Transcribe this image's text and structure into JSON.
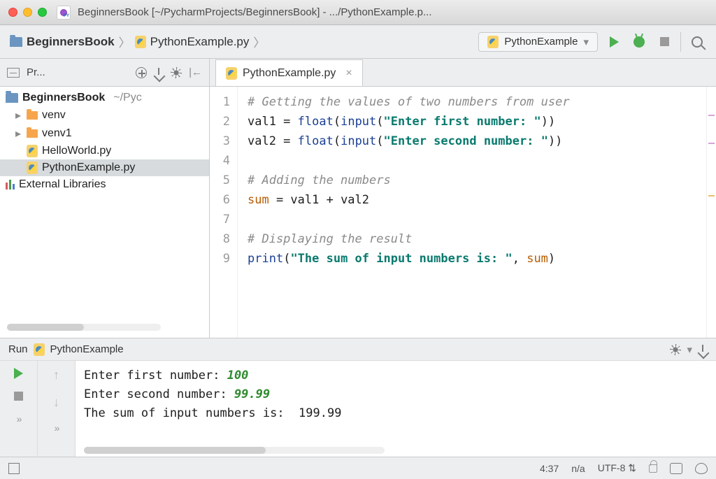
{
  "title": "BeginnersBook [~/PycharmProjects/BeginnersBook] - .../PythonExample.p...",
  "breadcrumbs": {
    "root": "BeginnersBook",
    "file": "PythonExample.py"
  },
  "run_config": {
    "name": "PythonExample"
  },
  "project": {
    "pane_label": "Pr...",
    "root_name": "BeginnersBook",
    "root_path": "~/Pyc",
    "items": [
      {
        "name": "venv",
        "type": "folder"
      },
      {
        "name": "venv1",
        "type": "folder"
      },
      {
        "name": "HelloWorld.py",
        "type": "py"
      },
      {
        "name": "PythonExample.py",
        "type": "py",
        "selected": true
      }
    ],
    "external": "External Libraries"
  },
  "editor": {
    "tab_name": "PythonExample.py",
    "highlight_line": 6,
    "lines": [
      [
        {
          "t": "# Getting the values of two numbers from user",
          "c": "cm"
        }
      ],
      [
        {
          "t": "val1 = ",
          "c": "var"
        },
        {
          "t": "float",
          "c": "fn"
        },
        {
          "t": "(",
          "c": ""
        },
        {
          "t": "input",
          "c": "fn"
        },
        {
          "t": "(",
          "c": ""
        },
        {
          "t": "\"Enter first number: \"",
          "c": "str"
        },
        {
          "t": "))",
          "c": ""
        }
      ],
      [
        {
          "t": "val2 = ",
          "c": "var"
        },
        {
          "t": "float",
          "c": "fn"
        },
        {
          "t": "(",
          "c": ""
        },
        {
          "t": "input",
          "c": "fn"
        },
        {
          "t": "(",
          "c": ""
        },
        {
          "t": "\"Enter second number: \"",
          "c": "str"
        },
        {
          "t": "))",
          "c": ""
        }
      ],
      [],
      [
        {
          "t": "# Adding the numbers",
          "c": "cm"
        }
      ],
      [
        {
          "t": "sum",
          "c": "kw"
        },
        {
          "t": " = val1 + val2",
          "c": ""
        }
      ],
      [],
      [
        {
          "t": "# Displaying the result",
          "c": "cm"
        }
      ],
      [
        {
          "t": "print",
          "c": "fn"
        },
        {
          "t": "(",
          "c": ""
        },
        {
          "t": "\"The sum of input numbers is: \"",
          "c": "str"
        },
        {
          "t": ", ",
          "c": ""
        },
        {
          "t": "sum",
          "c": "kw"
        },
        {
          "t": ")",
          "c": ""
        }
      ]
    ]
  },
  "run_panel": {
    "label": "Run",
    "config": "PythonExample",
    "output": [
      [
        {
          "t": "Enter first number: ",
          "c": ""
        },
        {
          "t": "100",
          "c": "inp"
        }
      ],
      [
        {
          "t": "Enter second number: ",
          "c": ""
        },
        {
          "t": "99.99",
          "c": "inp"
        }
      ],
      [
        {
          "t": "The sum of input numbers is:  199.99",
          "c": ""
        }
      ]
    ]
  },
  "status": {
    "pos": "4:37",
    "insp": "n/a",
    "enc": "UTF-8"
  }
}
